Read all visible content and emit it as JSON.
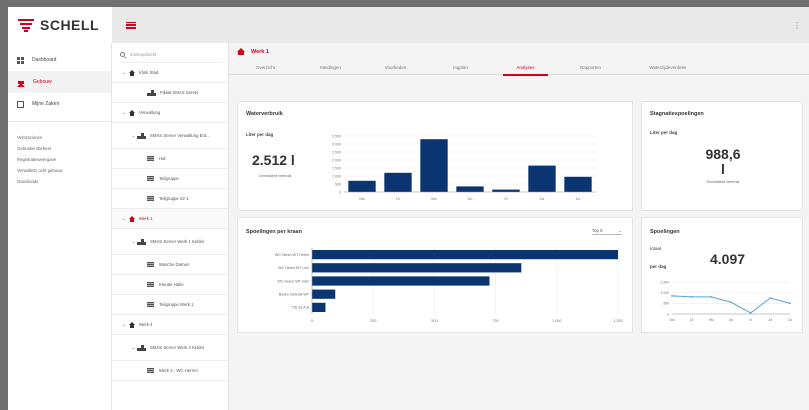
{
  "brand": {
    "name": "SCHELL"
  },
  "nav": {
    "items": [
      {
        "label": "Dashboard",
        "icon": "grid-icon"
      },
      {
        "label": "Gebouw",
        "icon": "house-icon",
        "active": true
      },
      {
        "label": "Mijne Zaken",
        "icon": "list-icon"
      }
    ],
    "links": [
      "Verbrazionen",
      "Gebruikersbeheer",
      "Registratieweergave",
      "Verwaltetn ocht gebouw",
      "Downloads"
    ]
  },
  "tree": {
    "search_placeholder": "Zoekopdracht",
    "rows": [
      {
        "level": 0,
        "chev": "⌄",
        "icon": "house",
        "label": "Klink Stad"
      },
      {
        "level": 2,
        "chev": "",
        "icon": "device",
        "label": "Filiaal SMAS Server"
      },
      {
        "level": 0,
        "chev": "⌄",
        "icon": "house",
        "label": "Verwaltung"
      },
      {
        "level": 1,
        "chev": "⌄",
        "icon": "device",
        "label": "SMAS Server Verwaltung Erd..."
      },
      {
        "level": 2,
        "chev": "",
        "icon": "group",
        "label": "Hal"
      },
      {
        "level": 2,
        "chev": "",
        "icon": "group",
        "label": "Teilgruppe"
      },
      {
        "level": 2,
        "chev": "",
        "icon": "group",
        "label": "Teilgruppe 42-1"
      },
      {
        "level": 0,
        "chev": "⌄",
        "icon": "house",
        "label": "Werk 1",
        "selected": true
      },
      {
        "level": 1,
        "chev": "⌄",
        "icon": "device",
        "label": "SMAS Server Werk 1 Kelder"
      },
      {
        "level": 2,
        "chev": "",
        "icon": "group",
        "label": "Wasche Damen"
      },
      {
        "level": 2,
        "chev": "",
        "icon": "group",
        "label": "Kleuter Halle"
      },
      {
        "level": 2,
        "chev": "",
        "icon": "group",
        "label": "Teilgruppe Werk 1"
      },
      {
        "level": 0,
        "chev": "⌄",
        "icon": "house",
        "label": "Werk 4"
      },
      {
        "level": 1,
        "chev": "⌄",
        "icon": "device",
        "label": "SMAS Server Werk 4 Kelder"
      },
      {
        "level": 2,
        "chev": "",
        "icon": "group",
        "label": "Werk 3 - WC Herren"
      }
    ]
  },
  "main": {
    "title": "Werk 1",
    "tabs": [
      "Overzicht",
      "Meldingen",
      "Voorkeden",
      "Ingplan",
      "Analyses",
      "Rapporten",
      "Waterzijdeverdeler"
    ],
    "active_tab": 4
  },
  "cards": {
    "water": {
      "title": "Waterverbruik",
      "sub": "Liter per dag",
      "value": "2.512 l",
      "note": "Gemiddeld verbruik"
    },
    "stagnation": {
      "title": "Stagnatiespoelingen",
      "sub": "Liter per dag",
      "value": "988,6",
      "unit": "l",
      "note": "Gemiddeld verbruik"
    },
    "flush": {
      "title": "Spoelingen per kraan",
      "dropdown": "Top 5",
      "dropdown_icon": "chevron-down-icon"
    },
    "flush_total": {
      "title": "Spoelingen",
      "sub1": "totaal",
      "sub2": "per dag",
      "value": "4.097"
    }
  },
  "chart_data": [
    {
      "type": "bar",
      "title": "Waterverbruik",
      "categories": [
        "Ma",
        "Di",
        "Wo",
        "Do",
        "Vr",
        "Za",
        "Zo"
      ],
      "values": [
        700,
        1200,
        3300,
        350,
        150,
        1650,
        950
      ],
      "y_ticks": [
        "0",
        "500",
        "1.000",
        "1.500",
        "2.000",
        "2.500",
        "3.000",
        "3.500"
      ],
      "ylim": [
        0,
        3500
      ],
      "color": "#0b3570"
    },
    {
      "type": "bar",
      "orientation": "horizontal",
      "title": "Spoelingen per kraan",
      "categories": [
        "WC Heren WT Heren",
        "WC Heren WT Urin",
        "WC Heren WT Inter",
        "Bosko Gebruik WT",
        "OS 33.A.B"
      ],
      "values": [
        1250,
        855,
        725,
        95,
        55
      ],
      "x_ticks": [
        "0",
        "250",
        "500",
        "750",
        "1.000",
        "1.250"
      ],
      "xlim": [
        0,
        1250
      ],
      "color": "#0b3570"
    },
    {
      "type": "line",
      "title": "Spoelingen",
      "categories": [
        "Ma",
        "Di",
        "Wo",
        "Do",
        "Vr",
        "Za",
        "Zo"
      ],
      "values": [
        850,
        800,
        800,
        550,
        50,
        750,
        500
      ],
      "y_ticks": [
        "0",
        "500",
        "1.000",
        "1.500"
      ],
      "ylim": [
        0,
        1500
      ],
      "color": "#5ba3cf"
    }
  ]
}
